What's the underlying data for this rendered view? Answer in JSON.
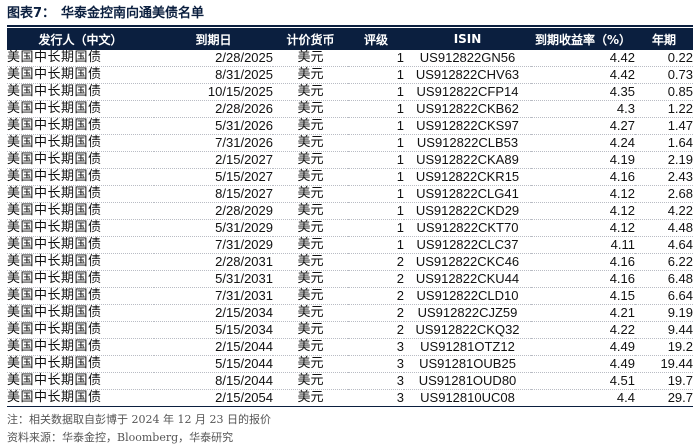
{
  "figure": {
    "label": "图表7：",
    "title": "华泰金控南向通美债名单"
  },
  "table": {
    "headers": [
      "发行人（中文）",
      "到期日",
      "计价货币",
      "评级",
      "ISIN",
      "到期收益率（%）",
      "年期"
    ],
    "rows": [
      [
        "美国中长期国债",
        "2/28/2025",
        "美元",
        "1",
        "US912822GN56",
        "4.42",
        "0.22"
      ],
      [
        "美国中长期国债",
        "8/31/2025",
        "美元",
        "1",
        "US912822CHV63",
        "4.42",
        "0.73"
      ],
      [
        "美国中长期国债",
        "10/15/2025",
        "美元",
        "1",
        "US912822CFP14",
        "4.35",
        "0.85"
      ],
      [
        "美国中长期国债",
        "2/28/2026",
        "美元",
        "1",
        "US912822CKB62",
        "4.3",
        "1.22"
      ],
      [
        "美国中长期国债",
        "5/31/2026",
        "美元",
        "1",
        "US912822CKS97",
        "4.27",
        "1.47"
      ],
      [
        "美国中长期国债",
        "7/31/2026",
        "美元",
        "1",
        "US912822CLB53",
        "4.24",
        "1.64"
      ],
      [
        "美国中长期国债",
        "2/15/2027",
        "美元",
        "1",
        "US912822CKA89",
        "4.19",
        "2.19"
      ],
      [
        "美国中长期国债",
        "5/15/2027",
        "美元",
        "1",
        "US912822CKR15",
        "4.16",
        "2.43"
      ],
      [
        "美国中长期国债",
        "8/15/2027",
        "美元",
        "1",
        "US912822CLG41",
        "4.12",
        "2.68"
      ],
      [
        "美国中长期国债",
        "2/28/2029",
        "美元",
        "1",
        "US912822CKD29",
        "4.12",
        "4.22"
      ],
      [
        "美国中长期国债",
        "5/31/2029",
        "美元",
        "1",
        "US912822CKT70",
        "4.12",
        "4.48"
      ],
      [
        "美国中长期国债",
        "7/31/2029",
        "美元",
        "1",
        "US912822CLC37",
        "4.11",
        "4.64"
      ],
      [
        "美国中长期国债",
        "2/28/2031",
        "美元",
        "2",
        "US912822CKC46",
        "4.16",
        "6.22"
      ],
      [
        "美国中长期国债",
        "5/31/2031",
        "美元",
        "2",
        "US912822CKU44",
        "4.16",
        "6.48"
      ],
      [
        "美国中长期国债",
        "7/31/2031",
        "美元",
        "2",
        "US912822CLD10",
        "4.15",
        "6.64"
      ],
      [
        "美国中长期国债",
        "2/15/2034",
        "美元",
        "2",
        "US912822CJZ59",
        "4.21",
        "9.19"
      ],
      [
        "美国中长期国债",
        "5/15/2034",
        "美元",
        "2",
        "US912822CKQ32",
        "4.22",
        "9.44"
      ],
      [
        "美国中长期国债",
        "2/15/2044",
        "美元",
        "3",
        "US91281OTZ12",
        "4.49",
        "19.2"
      ],
      [
        "美国中长期国债",
        "5/15/2044",
        "美元",
        "3",
        "US91281OUB25",
        "4.49",
        "19.44"
      ],
      [
        "美国中长期国债",
        "8/15/2044",
        "美元",
        "3",
        "US91281OUD80",
        "4.51",
        "19.7"
      ],
      [
        "美国中长期国债",
        "2/15/2054",
        "美元",
        "3",
        "US912810UC08",
        "4.4",
        "29.7"
      ]
    ]
  },
  "footer": {
    "note": "注：相关数据取自彭博于 2024 年 12 月 23 日的报价",
    "source": "资料来源：华泰金控，Bloomberg，华泰研究"
  },
  "colors": {
    "header_background": "#0b1f3f",
    "header_text": "#ffffff"
  }
}
